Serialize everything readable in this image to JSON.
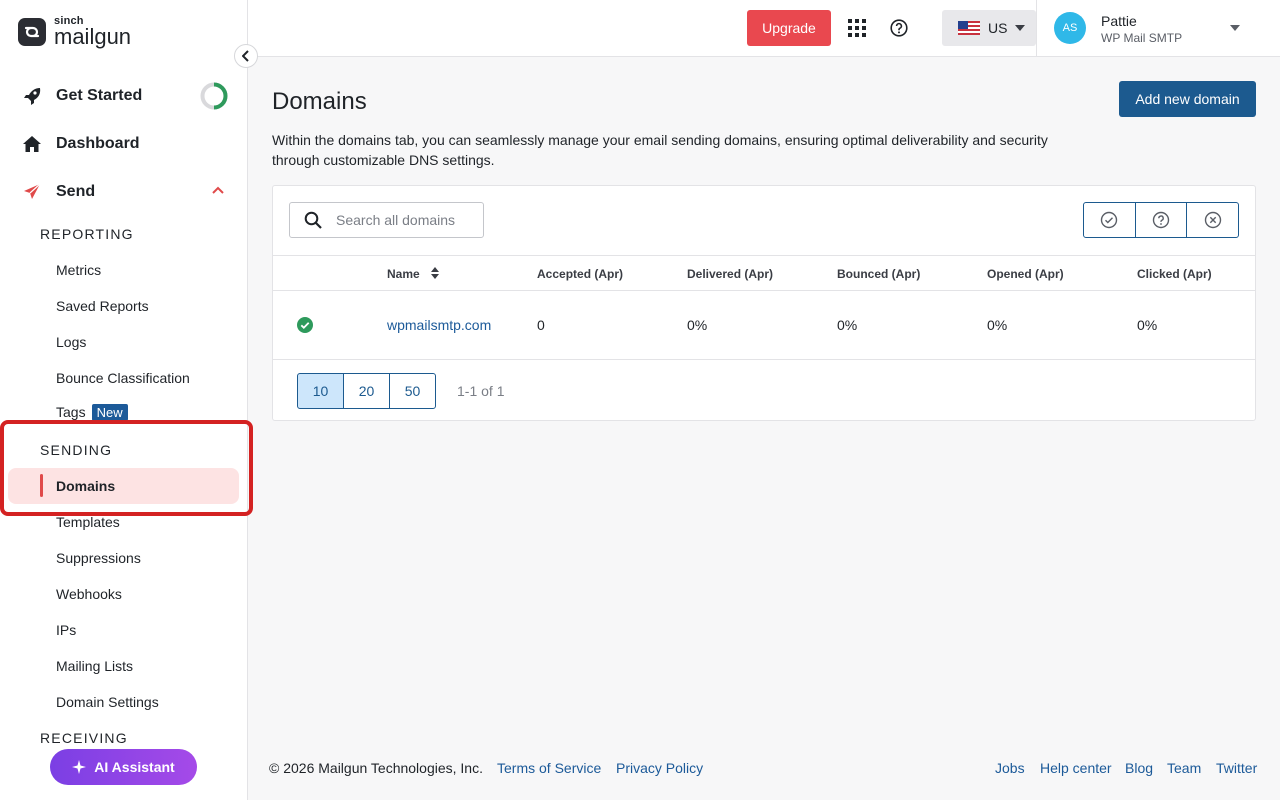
{
  "brand": {
    "small": "sinch",
    "big": "mailgun"
  },
  "sidebar": {
    "get_started": "Get Started",
    "dashboard": "Dashboard",
    "send": "Send",
    "reporting_head": "REPORTING",
    "reporting_items": [
      "Metrics",
      "Saved Reports",
      "Logs",
      "Bounce Classification",
      "Tags"
    ],
    "tags_badge": "New",
    "sending_head": "SENDING",
    "sending_items": [
      "Domains",
      "Templates",
      "Suppressions",
      "Webhooks",
      "IPs",
      "Mailing Lists",
      "Domain Settings"
    ],
    "receiving_head": "RECEIVING",
    "ai_assistant": "AI Assistant"
  },
  "topbar": {
    "upgrade": "Upgrade",
    "region": "US",
    "account_initials": "AS",
    "account_name": "Pattie",
    "account_org": "WP Mail SMTP"
  },
  "main": {
    "title": "Domains",
    "add_button": "Add new domain",
    "description": "Within the domains tab, you can seamlessly manage your email sending domains, ensuring optimal deliverability and security through customizable DNS settings.",
    "search_placeholder": "Search all domains",
    "columns": [
      "Name",
      "Accepted (Apr)",
      "Delivered (Apr)",
      "Bounced (Apr)",
      "Opened (Apr)",
      "Clicked (Apr)"
    ],
    "rows": [
      {
        "status": "verified",
        "name": "wpmailsmtp.com",
        "accepted": "0",
        "delivered": "0%",
        "bounced": "0%",
        "opened": "0%",
        "clicked": "0%"
      }
    ],
    "page_sizes": [
      "10",
      "20",
      "50"
    ],
    "page_size_selected": "10",
    "page_count": "1-1 of 1"
  },
  "footer": {
    "copyright": "© 2026 Mailgun Technologies, Inc.",
    "terms": "Terms of Service",
    "privacy": "Privacy Policy",
    "links": [
      "Jobs",
      "Help center",
      "Blog",
      "Team",
      "Twitter"
    ]
  },
  "colors": {
    "accent": "#1c5a8f",
    "upgrade": "#e9484f",
    "active_bg": "#fde3e3",
    "highlight": "#d42222",
    "verified": "#2e9a5c"
  }
}
